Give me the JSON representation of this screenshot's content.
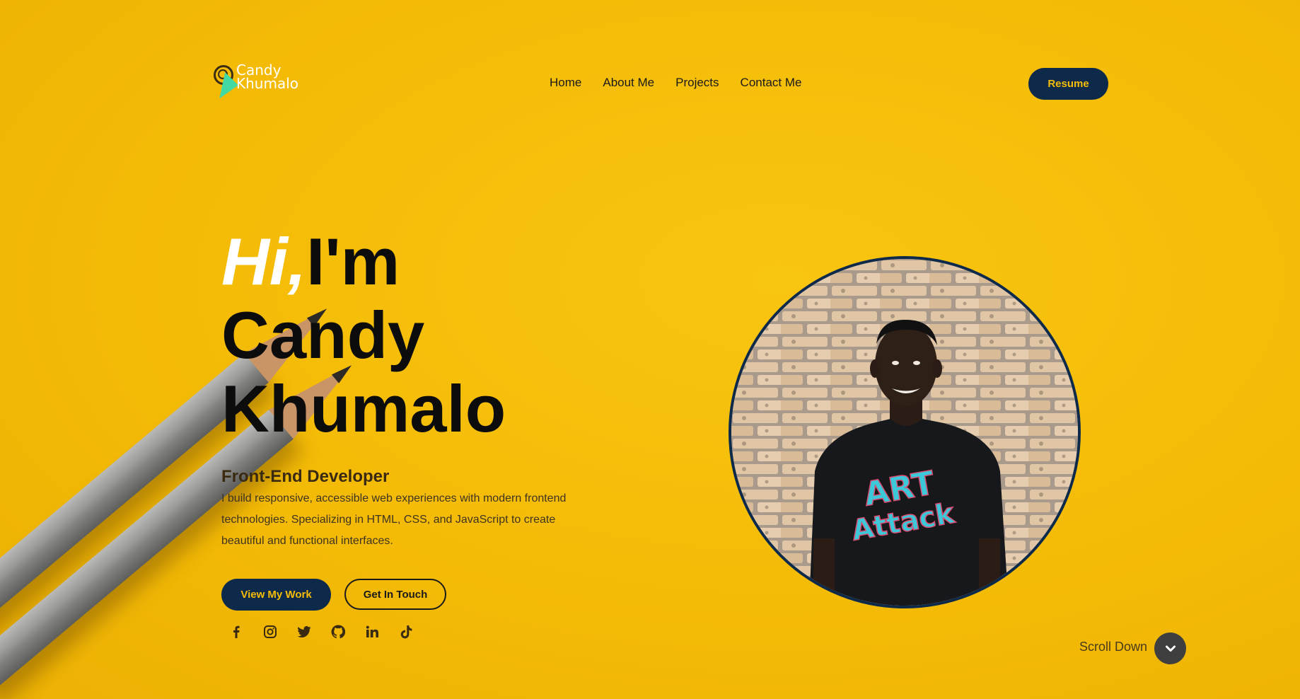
{
  "brand": {
    "logo_text_line1": "Candy",
    "logo_text_line2": "Khumalo"
  },
  "nav": {
    "items": [
      "Home",
      "About Me",
      "Projects",
      "Contact Me"
    ]
  },
  "header": {
    "resume_label": "Resume"
  },
  "hero": {
    "greeting_hi": "Hi,",
    "greeting_im": "I'm",
    "first_name": "Candy",
    "last_name": "Khumalo",
    "role": "Front-End Developer",
    "description": "I build responsive, accessible web experiences with modern frontend technologies. Specializing in HTML, CSS, and JavaScript to create beautiful and functional interfaces.",
    "primary_button": "View My Work",
    "secondary_button": "Get In Touch"
  },
  "socials": [
    "facebook-icon",
    "instagram-icon",
    "twitter-icon",
    "github-icon",
    "linkedin-icon",
    "tiktok-icon"
  ],
  "portrait": {
    "shirt_text_line1": "ART",
    "shirt_text_line2": "Attack"
  },
  "scroll": {
    "label": "Scroll Down"
  },
  "colors": {
    "background": "#f5bd08",
    "navy": "#0e2a4a",
    "accent_green": "#42d9a2"
  }
}
